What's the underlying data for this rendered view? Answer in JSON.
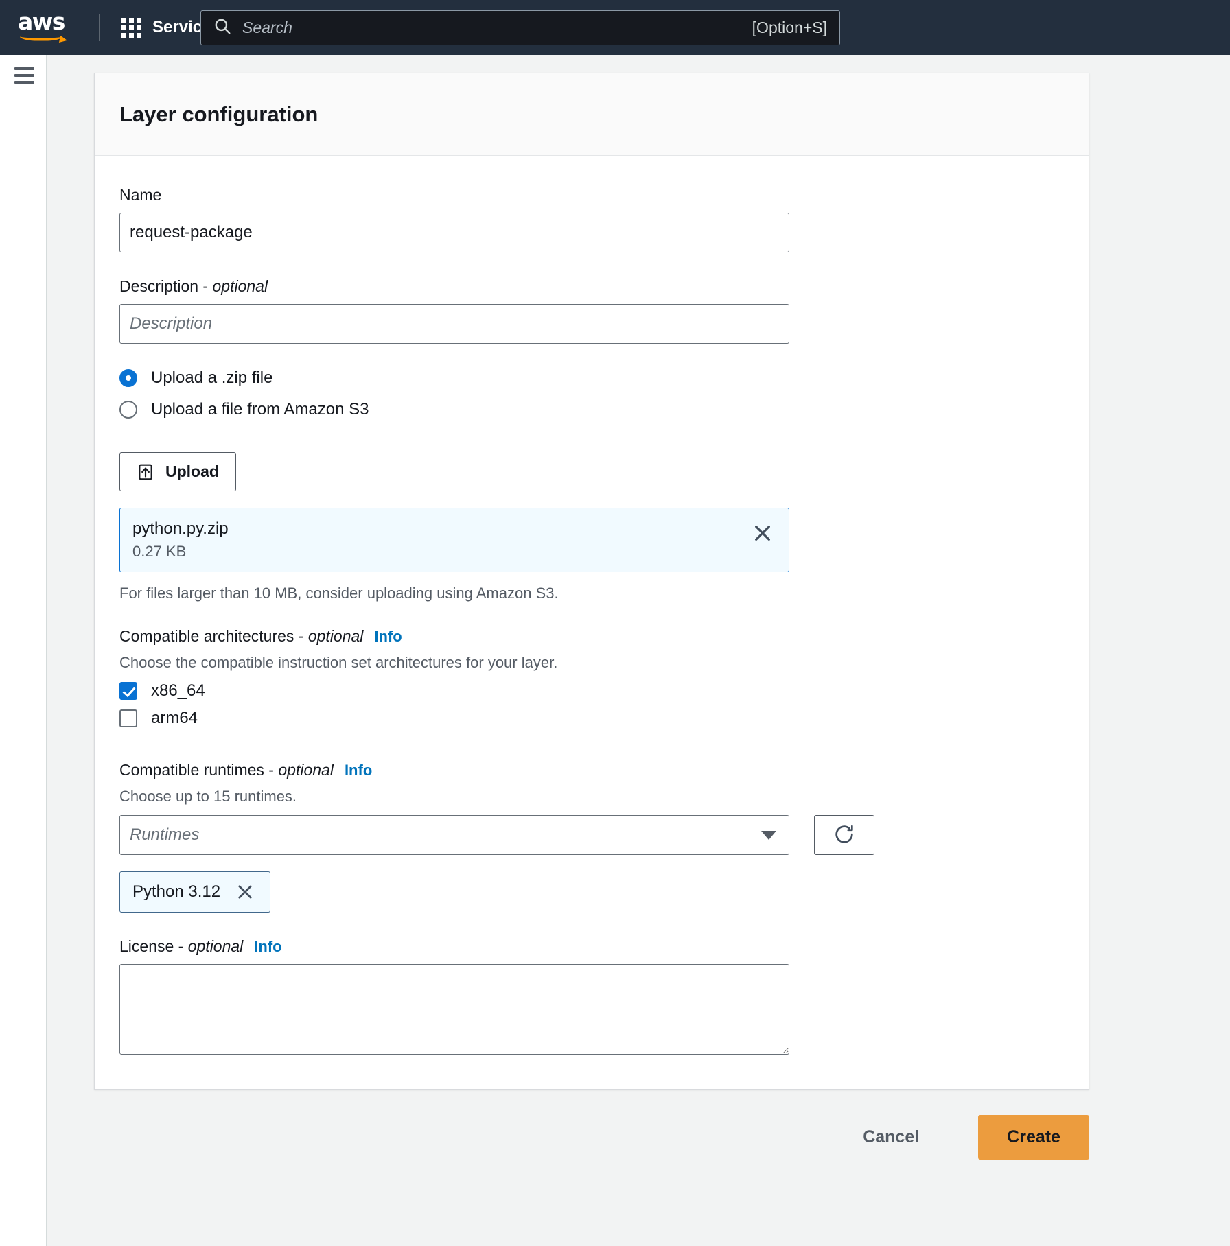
{
  "nav": {
    "logo_text": "aws",
    "services_label": "Services",
    "search_placeholder": "Search",
    "search_value": "",
    "search_shortcut": "[Option+S]",
    "search_icon": "search-icon",
    "grid_icon": "grid-apps-icon",
    "menu_icon": "hamburger-menu-icon"
  },
  "panel": {
    "title": "Layer configuration",
    "name": {
      "label": "Name",
      "value": "request-package"
    },
    "description": {
      "label": "Description - ",
      "label_optional": "optional",
      "placeholder": "Description",
      "value": ""
    },
    "source_options": [
      {
        "label": "Upload a .zip file",
        "selected": true
      },
      {
        "label": "Upload a file from Amazon S3",
        "selected": false
      }
    ],
    "upload": {
      "button_label": "Upload",
      "icon": "upload-arrow-icon",
      "file_name": "python.py.zip",
      "file_size": "0.27 KB",
      "remove_icon": "close-x-icon",
      "hint": "For files larger than 10 MB, consider uploading using Amazon S3."
    },
    "architectures": {
      "label": "Compatible architectures - ",
      "label_optional": "optional",
      "info_label": "Info",
      "description": "Choose the compatible instruction set architectures for your layer.",
      "items": [
        {
          "label": "x86_64",
          "checked": true
        },
        {
          "label": "arm64",
          "checked": false
        }
      ]
    },
    "runtimes": {
      "label": "Compatible runtimes - ",
      "label_optional": "optional",
      "info_label": "Info",
      "description": "Choose up to 15 runtimes.",
      "select_placeholder": "Runtimes",
      "select_value": "",
      "caret_icon": "chevron-down-icon",
      "refresh_icon": "refresh-icon",
      "selected_tokens": [
        {
          "label": "Python 3.12",
          "remove_icon": "close-x-icon"
        }
      ]
    },
    "license": {
      "label": "License - ",
      "label_optional": "optional",
      "info_label": "Info",
      "value": "",
      "placeholder": ""
    }
  },
  "footer": {
    "cancel_label": "Cancel",
    "create_label": "Create"
  },
  "colors": {
    "nav_background": "#232f3e",
    "accent_blue": "#0972d3",
    "link_blue": "#0073bb",
    "create_orange": "#ec9c3e",
    "logo_orange": "#ff9900"
  }
}
